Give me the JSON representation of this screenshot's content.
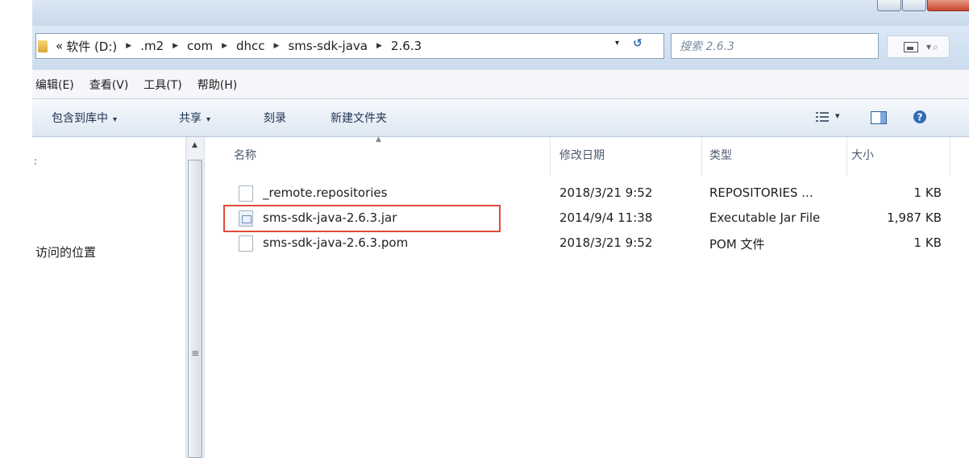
{
  "address": {
    "prefix": "«",
    "crumbs": [
      "软件 (D:)",
      ".m2",
      "com",
      "dhcc",
      "sms-sdk-java",
      "2.6.3"
    ],
    "dropdown_glyph": "▾",
    "refresh_glyph": "↺"
  },
  "search": {
    "placeholder": "搜索 2.6.3"
  },
  "view_button": {
    "caret": "▾",
    "search_glyph": "⌕"
  },
  "menu": [
    "编辑(E)",
    "查看(V)",
    "工具(T)",
    "帮助(H)"
  ],
  "toolbar": {
    "items": [
      "包含到库中",
      "共享",
      "刻录",
      "新建文件夹"
    ],
    "caret": "▾",
    "right_caret": "▾",
    "help_glyph": "?"
  },
  "nav": {
    "location": "访问的位置",
    "mark": ":"
  },
  "columns": {
    "name": "名称",
    "date": "修改日期",
    "type": "类型",
    "size": "大小"
  },
  "files": [
    {
      "name": "_remote.repositories",
      "date": "2018/3/21 9:52",
      "type": "REPOSITORIES ...",
      "size": "1 KB",
      "icon": "blank-file-icon"
    },
    {
      "name": "sms-sdk-java-2.6.3.jar",
      "date": "2014/9/4 11:38",
      "type": "Executable Jar File",
      "size": "1,987 KB",
      "icon": "jar-file-icon"
    },
    {
      "name": "sms-sdk-java-2.6.3.pom",
      "date": "2018/3/21 9:52",
      "type": "POM 文件",
      "size": "1 KB",
      "icon": "blank-file-icon"
    }
  ],
  "scrollbar": {
    "up_glyph": "▲",
    "grip_glyph": "≡"
  },
  "colors": {
    "accent": "#2f6db5",
    "highlight": "#e24a3b"
  }
}
